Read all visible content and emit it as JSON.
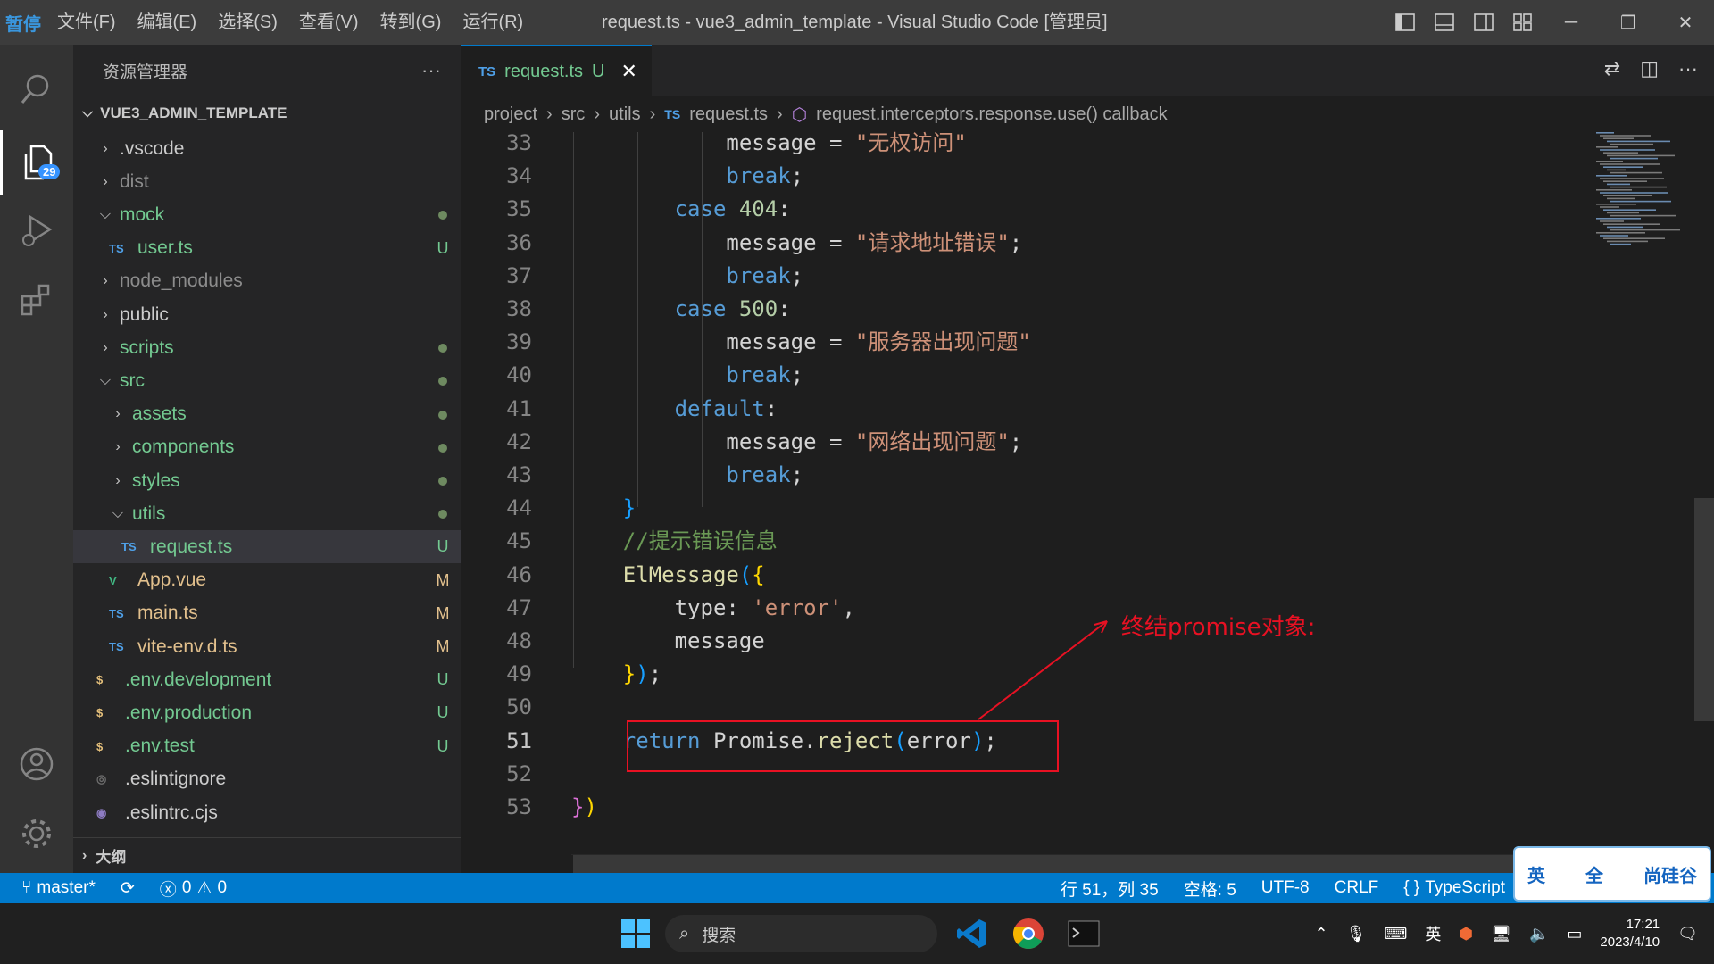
{
  "titlebar": {
    "pause_label": "暂停",
    "menus": [
      "文件(F)",
      "编辑(E)",
      "选择(S)",
      "查看(V)",
      "转到(G)",
      "运行(R)"
    ],
    "title": "request.ts - vue3_admin_template - Visual Studio Code [管理员]"
  },
  "activity": {
    "explorer_badge": "29"
  },
  "sidebar": {
    "header": "资源管理器",
    "more": "···",
    "root": "VUE3_ADMIN_TEMPLATE",
    "outline": "大纲",
    "items": [
      {
        "name": ".vscode",
        "kind": "folder",
        "open": false,
        "depth": 1,
        "status": "",
        "color": "#cccccc"
      },
      {
        "name": "dist",
        "kind": "folder",
        "open": false,
        "depth": 1,
        "status": "",
        "color": "#8c8c8c"
      },
      {
        "name": "mock",
        "kind": "folder",
        "open": true,
        "depth": 1,
        "status": "dot",
        "color": "#73c991"
      },
      {
        "name": "user.ts",
        "kind": "ts",
        "depth": 2,
        "status": "U",
        "color": "#73c991"
      },
      {
        "name": "node_modules",
        "kind": "folder",
        "open": false,
        "depth": 1,
        "status": "",
        "color": "#8c8c8c"
      },
      {
        "name": "public",
        "kind": "folder",
        "open": false,
        "depth": 1,
        "status": "",
        "color": "#cccccc"
      },
      {
        "name": "scripts",
        "kind": "folder",
        "open": false,
        "depth": 1,
        "status": "dot",
        "color": "#73c991"
      },
      {
        "name": "src",
        "kind": "folder",
        "open": true,
        "depth": 1,
        "status": "dot",
        "color": "#73c991"
      },
      {
        "name": "assets",
        "kind": "folder",
        "open": false,
        "depth": 2,
        "status": "dot",
        "color": "#73c991"
      },
      {
        "name": "components",
        "kind": "folder",
        "open": false,
        "depth": 2,
        "status": "dot",
        "color": "#73c991"
      },
      {
        "name": "styles",
        "kind": "folder",
        "open": false,
        "depth": 2,
        "status": "dot",
        "color": "#73c991"
      },
      {
        "name": "utils",
        "kind": "folder",
        "open": true,
        "depth": 2,
        "status": "dot",
        "color": "#73c991"
      },
      {
        "name": "request.ts",
        "kind": "ts",
        "depth": 3,
        "status": "U",
        "color": "#73c991",
        "selected": true
      },
      {
        "name": "App.vue",
        "kind": "vue",
        "depth": 2,
        "status": "M",
        "color": "#e2c08d"
      },
      {
        "name": "main.ts",
        "kind": "ts",
        "depth": 2,
        "status": "M",
        "color": "#e2c08d"
      },
      {
        "name": "vite-env.d.ts",
        "kind": "ts",
        "depth": 2,
        "status": "M",
        "color": "#e2c08d"
      },
      {
        "name": ".env.development",
        "kind": "env",
        "depth": 1,
        "status": "U",
        "color": "#73c991"
      },
      {
        "name": ".env.production",
        "kind": "env",
        "depth": 1,
        "status": "U",
        "color": "#73c991"
      },
      {
        "name": ".env.test",
        "kind": "env",
        "depth": 1,
        "status": "U",
        "color": "#73c991"
      },
      {
        "name": ".eslintignore",
        "kind": "eslint",
        "depth": 1,
        "status": "",
        "color": "#cccccc"
      },
      {
        "name": ".eslintrc.cjs",
        "kind": "eslintrc",
        "depth": 1,
        "status": "",
        "color": "#cccccc"
      }
    ]
  },
  "editor": {
    "tab": {
      "icon": "TS",
      "label": "request.ts",
      "status": "U",
      "close": "✕"
    },
    "breadcrumb": [
      "project",
      "src",
      "utils",
      "request.ts",
      "request.interceptors.response.use() callback"
    ],
    "annotation": "终结promise对象:",
    "current_line": 51
  },
  "code_lines": [
    {
      "n": 33,
      "html": "            <span class='p'>message = </span><span class='s'>\"无权访问\"</span>"
    },
    {
      "n": 34,
      "html": "            <span class='k'>break</span><span class='p'>;</span>"
    },
    {
      "n": 35,
      "html": "        <span class='k'>case</span> <span class='n'>404</span><span class='p'>:</span>"
    },
    {
      "n": 36,
      "html": "            <span class='p'>message = </span><span class='s'>\"请求地址错误\"</span><span class='p'>;</span>"
    },
    {
      "n": 37,
      "html": "            <span class='k'>break</span><span class='p'>;</span>"
    },
    {
      "n": 38,
      "html": "        <span class='k'>case</span> <span class='n'>500</span><span class='p'>:</span>"
    },
    {
      "n": 39,
      "html": "            <span class='p'>message = </span><span class='s'>\"服务器出现问题\"</span>"
    },
    {
      "n": 40,
      "html": "            <span class='k'>break</span><span class='p'>;</span>"
    },
    {
      "n": 41,
      "html": "        <span class='k'>default</span><span class='p'>:</span>"
    },
    {
      "n": 42,
      "html": "            <span class='p'>message = </span><span class='s'>\"网络出现问题\"</span><span class='p'>;</span>"
    },
    {
      "n": 43,
      "html": "            <span class='k'>break</span><span class='p'>;</span>"
    },
    {
      "n": 44,
      "html": "    <span class='b3'>}</span>"
    },
    {
      "n": 45,
      "html": "    <span class='c'>//提示错误信息</span>"
    },
    {
      "n": 46,
      "html": "    <span class='f'>ElMessage</span><span class='b3'>(</span><span class='b1'>{</span>"
    },
    {
      "n": 47,
      "html": "        <span class='p'>type: </span><span class='s'>'error'</span><span class='p'>,</span>"
    },
    {
      "n": 48,
      "html": "        <span class='p'>message</span>"
    },
    {
      "n": 49,
      "html": "    <span class='b1'>}</span><span class='b3'>)</span><span class='p'>;</span>"
    },
    {
      "n": 50,
      "html": ""
    },
    {
      "n": 51,
      "html": "    <span class='k'>return</span> <span class='p'>Promise.</span><span class='f'>reject</span><span class='b3'>(</span><span class='p'>error</span><span class='b3'>)</span><span class='p'>;</span>"
    },
    {
      "n": 52,
      "html": ""
    },
    {
      "n": 53,
      "html": "<span class='b2'>}</span><span class='b1'>)</span>"
    }
  ],
  "status": {
    "branch": "master*",
    "errors": "0",
    "warnings": "0",
    "position": "行 51，列 35",
    "spaces": "空格: 5",
    "encoding": "UTF-8",
    "eol": "CRLF",
    "language": "TypeScript"
  },
  "ime_widget": {
    "lang": "英",
    "brand": "尚硅谷",
    "full": "全"
  },
  "taskbar": {
    "search_placeholder": "搜索",
    "ime": "英",
    "time": "17:21",
    "date": "2023/4/10"
  }
}
